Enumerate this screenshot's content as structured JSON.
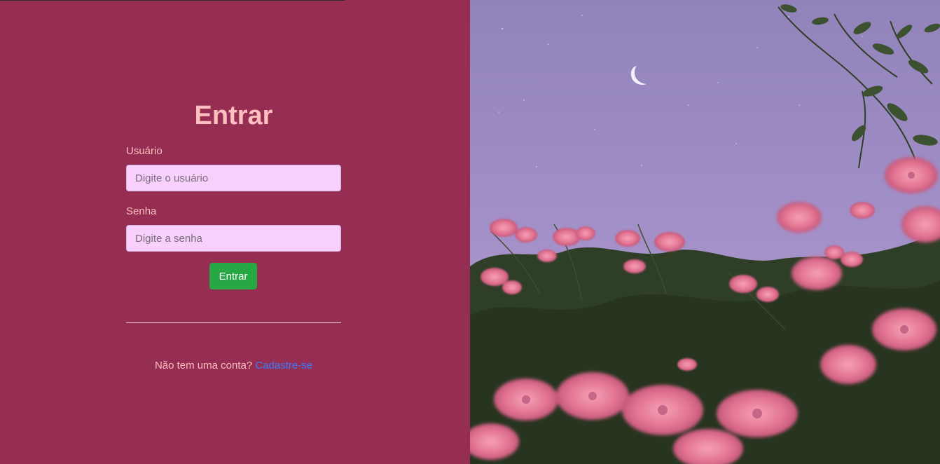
{
  "login": {
    "title": "Entrar",
    "username_label": "Usuário",
    "username_placeholder": "Digite o usuário",
    "password_label": "Senha",
    "password_placeholder": "Digite a senha",
    "submit_label": "Entrar",
    "signup_prompt": "Não tem uma conta?",
    "signup_link": "Cadastre-se"
  },
  "colors": {
    "panel_background": "#962d53",
    "title_text": "#fdbfbf",
    "input_background": "#f7d1fb",
    "submit_button": "#28a745",
    "link": "#3f7bff",
    "sky": "#9a8ac2"
  },
  "photo": {
    "subject_icons": [
      "crescent-moon-icon",
      "stars-icon",
      "pink-flowers-icon",
      "foliage-icon"
    ]
  }
}
